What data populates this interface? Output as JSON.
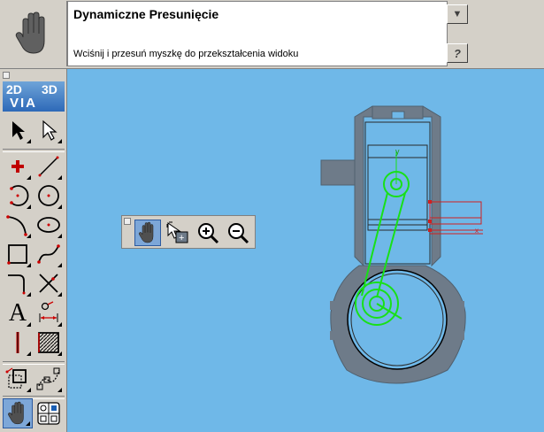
{
  "header": {
    "command_title": "Dynamiczne Presunięcie",
    "command_hint": "Wciśnij i przesuń myszkę do przekształcenia widoku",
    "dropdown_glyph": "▼",
    "help_glyph": "?"
  },
  "toolbox": {
    "logo_2d": "2D",
    "logo_3d": "3D",
    "logo_via": "VIA",
    "active_tool": "pan-hand"
  },
  "canvas": {
    "background": "#6fb8e8",
    "part_color": "#6e7b89",
    "highlight_color": "#18e018",
    "constraint_color": "#d02020",
    "axis_y_label": "y",
    "axis_x_label": "x"
  },
  "float_bar": {
    "tools": [
      "pan-hand-icon",
      "zoom-window-icon",
      "zoom-in-icon",
      "zoom-out-icon"
    ]
  }
}
